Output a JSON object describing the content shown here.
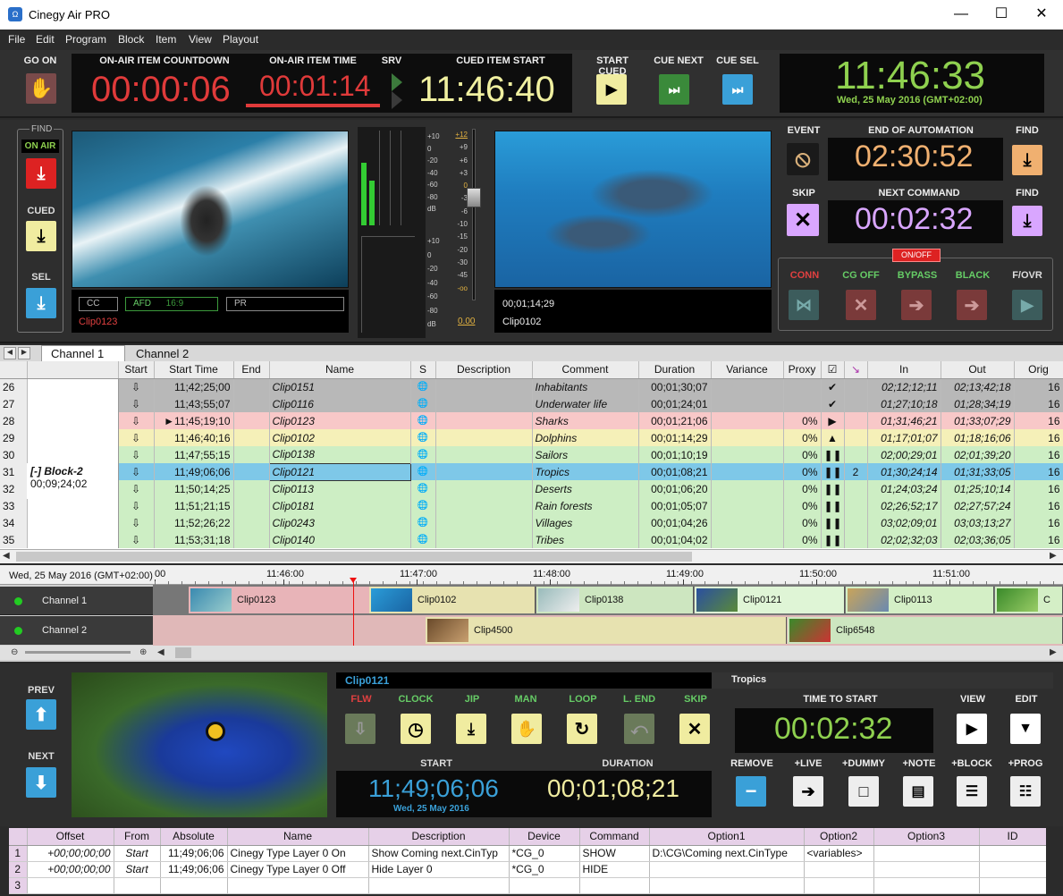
{
  "app": {
    "title": "Cinegy Air PRO",
    "min": "—",
    "max": "☐",
    "close": "✕"
  },
  "menu": [
    "File",
    "Edit",
    "Program",
    "Block",
    "Item",
    "View",
    "Playout"
  ],
  "top": {
    "go_on": "GO ON",
    "countdown_label": "ON-AIR ITEM COUNTDOWN",
    "countdown": "00:00:06",
    "item_time_label": "ON-AIR ITEM TIME",
    "item_time": "00:01:14",
    "srv": "SRV",
    "cued_start_label": "CUED ITEM START",
    "cued_start": "11:46:40",
    "start_cued": "START CUED",
    "cue_next": "CUE NEXT",
    "cue_sel": "CUE SEL",
    "clock": "11:46:33",
    "date": "Wed, 25 May 2016 (GMT+02:00)"
  },
  "find": {
    "title": "FIND",
    "on_air": "ON AIR",
    "cued": "CUED",
    "sel": "SEL"
  },
  "preview_left": {
    "cc": "CC",
    "afd": "AFD",
    "afd_val": "16:9",
    "pr": "PR",
    "clip": "Clip0123"
  },
  "audio_scale": [
    "+10",
    "0",
    "-20",
    "-40",
    "-60",
    "-80",
    "dB"
  ],
  "fader_scale": [
    "+12",
    "+9",
    "+6",
    "+3",
    "0",
    "-3",
    "-6",
    "-10",
    "-15",
    "-20",
    "-30",
    "-45",
    "-oo"
  ],
  "fader_val": "0.00",
  "preview_right": {
    "tc": "00;01;14;29",
    "clip": "Clip0102"
  },
  "automation": {
    "event": "EVENT",
    "end_label": "END OF AUTOMATION",
    "end": "02:30:52",
    "find": "FIND",
    "skip": "SKIP",
    "next_label": "NEXT COMMAND",
    "next": "00:02:32",
    "find2": "FIND",
    "onoff": "ON/OFF",
    "conn": "CONN",
    "cg_off": "CG OFF",
    "bypass": "BYPASS",
    "black": "BLACK",
    "fovr": "F/OVR"
  },
  "tabs": [
    "Channel 1",
    "Channel 2"
  ],
  "grid": {
    "columns": [
      "",
      "Start",
      "Start Time",
      "End",
      "Name",
      "S",
      "Description",
      "Comment",
      "Duration",
      "Variance",
      "Proxy",
      "☑",
      "↘",
      "In",
      "Out",
      "Orig"
    ],
    "block": {
      "name": "[-]  Block-2",
      "dur": "00;09;24;02"
    },
    "rows": [
      [
        "26",
        "⇩",
        "11;42;25;00",
        "",
        "Clip0151",
        "",
        "",
        "Inhabitants",
        "00;01;30;07",
        "",
        "",
        "✔",
        "",
        "02;12;12;11",
        "02;13;42;18",
        "16"
      ],
      [
        "27",
        "⇩",
        "11;43;55;07",
        "",
        "Clip0116",
        "",
        "",
        "Underwater life",
        "00;01;24;01",
        "",
        "",
        "✔",
        "",
        "01;27;10;18",
        "01;28;34;19",
        "16"
      ],
      [
        "28",
        "⇩",
        "►11;45;19;10",
        "",
        "Clip0123",
        "",
        "",
        "Sharks",
        "00;01;21;06",
        "",
        "0%",
        "▶",
        "",
        "01;31;46;21",
        "01;33;07;29",
        "16"
      ],
      [
        "29",
        "⇩",
        "11;46;40;16",
        "",
        "Clip0102",
        "",
        "",
        "Dolphins",
        "00;01;14;29",
        "",
        "0%",
        "▲",
        "",
        "01;17;01;07",
        "01;18;16;06",
        "16"
      ],
      [
        "30",
        "⇩",
        "11;47;55;15",
        "",
        "Clip0138",
        "",
        "",
        "Sailors",
        "00;01;10;19",
        "",
        "0%",
        "❚❚",
        "",
        "02;00;29;01",
        "02;01;39;20",
        "16"
      ],
      [
        "31",
        "⇩",
        "11;49;06;06",
        "",
        "Clip0121",
        "",
        "",
        "Tropics",
        "00;01;08;21",
        "",
        "0%",
        "❚❚",
        "2",
        "01;30;24;14",
        "01;31;33;05",
        "16"
      ],
      [
        "32",
        "⇩",
        "11;50;14;25",
        "",
        "Clip0113",
        "",
        "",
        "Deserts",
        "00;01;06;20",
        "",
        "0%",
        "❚❚",
        "",
        "01;24;03;24",
        "01;25;10;14",
        "16"
      ],
      [
        "33",
        "⇩",
        "11;51;21;15",
        "",
        "Clip0181",
        "",
        "",
        "Rain forests",
        "00;01;05;07",
        "",
        "0%",
        "❚❚",
        "",
        "02;26;52;17",
        "02;27;57;24",
        "16"
      ],
      [
        "34",
        "⇩",
        "11;52;26;22",
        "",
        "Clip0243",
        "",
        "",
        "Villages",
        "00;01;04;26",
        "",
        "0%",
        "❚❚",
        "",
        "03;02;09;01",
        "03;03;13;27",
        "16"
      ],
      [
        "35",
        "⇩",
        "11;53;31;18",
        "",
        "Clip0140",
        "",
        "",
        "Tribes",
        "00;01;04;02",
        "",
        "0%",
        "❚❚",
        "",
        "02;02;32;03",
        "02;03;36;05",
        "16"
      ]
    ]
  },
  "timeline": {
    "date": "Wed, 25 May 2016 (GMT+02:00)",
    "ticks": [
      "00",
      "11:46:00",
      "11:47:00",
      "11:48:00",
      "11:49:00",
      "11:50:00",
      "11:51:00"
    ],
    "ch1": "Channel 1",
    "ch2": "Channel 2",
    "ch1_clips": [
      "Clip0123",
      "Clip0102",
      "Clip0138",
      "Clip0121",
      "Clip0113",
      "C"
    ],
    "ch2_clips": [
      "Clip4500",
      "Clip6548"
    ]
  },
  "bottom": {
    "prev": "PREV",
    "next": "NEXT",
    "clip": "Clip0121",
    "title": "Tropics",
    "flw": "FLW",
    "clock": "CLOCK",
    "jip": "JIP",
    "man": "MAN",
    "loop": "LOOP",
    "lend": "L. END",
    "skip": "SKIP",
    "start_label": "START",
    "start": "11;49;06;06",
    "start_date": "Wed, 25 May 2016",
    "dur_label": "DURATION",
    "dur": "00;01;08;21",
    "tts_label": "TIME TO START",
    "tts": "00:02:32",
    "view": "VIEW",
    "edit": "EDIT",
    "remove": "REMOVE",
    "live": "+LIVE",
    "dummy": "+DUMMY",
    "note": "+NOTE",
    "block": "+BLOCK",
    "prog": "+PROG"
  },
  "cmd": {
    "columns": [
      "",
      "Offset",
      "From",
      "Absolute",
      "Name",
      "Description",
      "Device",
      "Command",
      "Option1",
      "Option2",
      "Option3",
      "ID"
    ],
    "rows": [
      [
        "1",
        "+00;00;00;00",
        "Start",
        "11;49;06;06",
        "Cinegy Type Layer 0 On",
        "Show Coming next.CinTyp",
        "*CG_0",
        "SHOW",
        "D:\\CG\\Coming next.CinType",
        "<variables>",
        "",
        ""
      ],
      [
        "2",
        "+00;00;00;00",
        "Start",
        "11;49;06;06",
        "Cinegy Type Layer 0 Off",
        "Hide Layer 0",
        "*CG_0",
        "HIDE",
        "",
        "",
        "",
        ""
      ],
      [
        "3",
        "",
        "",
        "",
        "",
        "",
        "",
        "",
        "",
        "",
        "",
        ""
      ]
    ]
  },
  "colors": {
    "accent_red": "#d22",
    "green_lcd": "#8fd14f",
    "orange_lcd": "#f0b070",
    "purple_lcd": "#d9a6ff"
  }
}
